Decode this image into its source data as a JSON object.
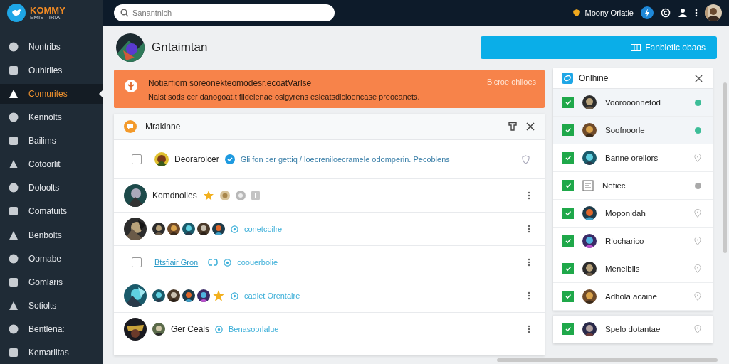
{
  "app": {
    "logo_title": "KOMMY",
    "logo_subtitle": "EMIS  ·IRIA"
  },
  "sidebar": {
    "items": [
      {
        "label": "Nontribs",
        "selected": false
      },
      {
        "label": "Ouhirlies",
        "selected": false
      },
      {
        "label": "Comurites",
        "selected": true
      },
      {
        "label": "Kennolts",
        "selected": false
      },
      {
        "label": "Bailims",
        "selected": false
      },
      {
        "label": "Cotoorlit",
        "selected": false
      },
      {
        "label": "Doloolts",
        "selected": false
      },
      {
        "label": "Comatuits",
        "selected": false
      },
      {
        "label": "Benbolts",
        "selected": false
      },
      {
        "label": "Oomabe",
        "selected": false
      },
      {
        "label": "Gomlaris",
        "selected": false
      },
      {
        "label": "Sotiolts",
        "selected": false
      },
      {
        "label": "Bentlena:",
        "selected": false
      },
      {
        "label": "Kemarlitas",
        "selected": false
      }
    ]
  },
  "topbar": {
    "search": {
      "placeholder": "Sanantnich"
    },
    "account": "Moony Orlatie"
  },
  "header": {
    "title": "Gntaimtan",
    "button": "Fanbietic obaos"
  },
  "notification": {
    "title": "Notiarfiom soreonekteomodesr.ecoatVarlse",
    "body": "Nalst.sods cer danogoat.t fildeienae oslgyrens esleatsdicloencase preocanets.",
    "action": "Bicroe ohiloes"
  },
  "panel": {
    "title": "Mrakinne",
    "rows": [
      {
        "kind": "post",
        "checked": false,
        "name": "Deorarolcer",
        "text": "Gli fon cer gettiq / loecreniloecramele odomperin. Pecoblens"
      },
      {
        "kind": "badges",
        "name": "Komdnolies"
      },
      {
        "kind": "group",
        "star": false,
        "status": "conetcoilre"
      },
      {
        "kind": "link",
        "checked": false,
        "name": "Btsfiair Gron",
        "status": "coouerbolie"
      },
      {
        "kind": "group",
        "star": true,
        "status": "cadlet Orentaire"
      },
      {
        "kind": "member",
        "name": "Ger Ceals",
        "status": "Benasobrlalue"
      }
    ]
  },
  "online": {
    "title": "Onlhine",
    "items": [
      {
        "name": "Voorooonnetod",
        "kind": "picture",
        "checked": true,
        "selected": true,
        "color": "#3dbd98"
      },
      {
        "name": "Soofnoorle",
        "kind": "picture",
        "checked": true,
        "selected": true,
        "color": "#3dbd98"
      },
      {
        "name": "Banne oreliors",
        "kind": "picture",
        "checked": true,
        "selected": false
      },
      {
        "name": "Nefiec",
        "kind": "document",
        "checked": true,
        "selected": false,
        "color": "#a9a9a9"
      },
      {
        "name": "Moponidah",
        "kind": "picture",
        "checked": true,
        "selected": false
      },
      {
        "name": "Rlocharico",
        "kind": "picture",
        "checked": true,
        "selected": false
      },
      {
        "name": "Menelbiis",
        "kind": "picture",
        "checked": true,
        "selected": false
      },
      {
        "name": "Adhola acaine",
        "kind": "picture",
        "checked": true,
        "selected": false
      }
    ],
    "more_items": [
      {
        "name": "Spelo dotantae",
        "kind": "picture",
        "checked": true,
        "selected": false
      }
    ]
  }
}
